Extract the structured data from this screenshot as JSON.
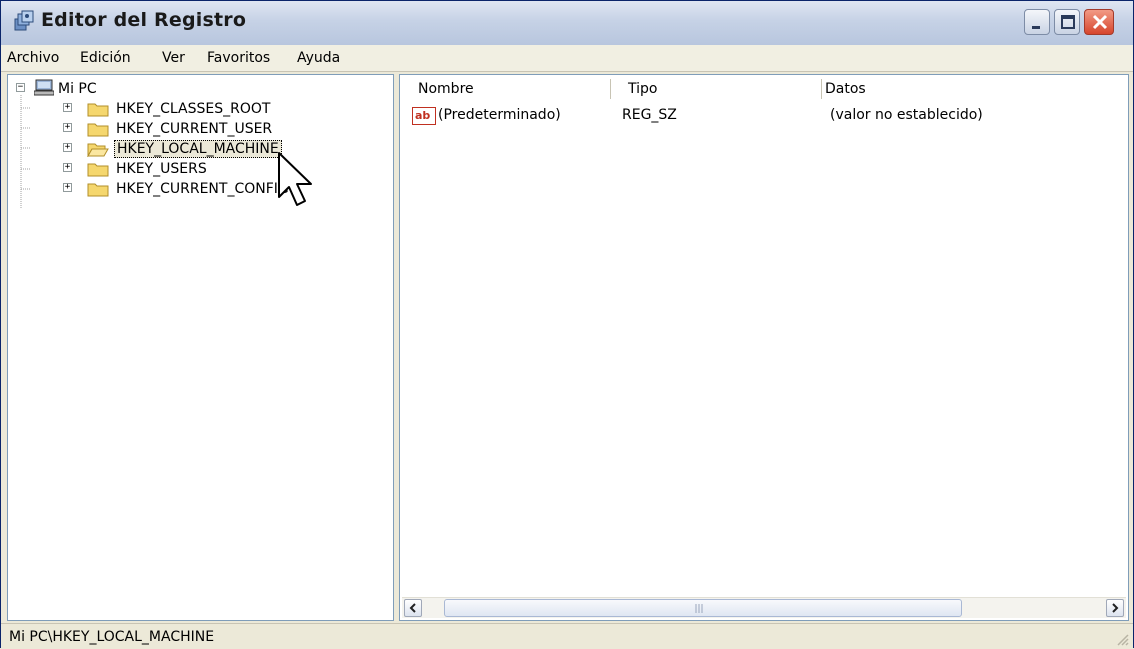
{
  "window": {
    "title": "Editor del Registro"
  },
  "menu": [
    "Archivo",
    "Edición",
    "Ver",
    "Favoritos",
    "Ayuda"
  ],
  "tree": {
    "root": "Mi PC",
    "keys": [
      "HKEY_CLASSES_ROOT",
      "HKEY_CURRENT_USER",
      "HKEY_LOCAL_MACHINE",
      "HKEY_USERS",
      "HKEY_CURRENT_CONFIG"
    ],
    "selected": "HKEY_LOCAL_MACHINE",
    "expander_symbol": "+",
    "root_expander_symbol": "−"
  },
  "list": {
    "columns": [
      "Nombre",
      "Tipo",
      "Datos"
    ],
    "rows": [
      {
        "icon": "ab-string-icon",
        "name": "(Predeterminado)",
        "type": "REG_SZ",
        "data": "(valor no establecido)"
      }
    ]
  },
  "statusbar": {
    "path": "Mi PC\\HKEY_LOCAL_MACHINE"
  },
  "colors": {
    "title_gradient_top": "#dfe6f2",
    "close_button": "#d6452c",
    "folder": "#f5d76e",
    "pane_border": "#7f9db9"
  }
}
